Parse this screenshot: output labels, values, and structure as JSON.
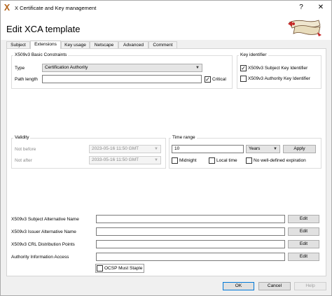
{
  "window": {
    "title": "X Certificate and Key management",
    "help_glyph": "?",
    "close_glyph": "✕"
  },
  "dialog": {
    "heading": "Edit XCA template"
  },
  "tabs": [
    {
      "label": "Subject"
    },
    {
      "label": "Extensions"
    },
    {
      "label": "Key usage"
    },
    {
      "label": "Netscape"
    },
    {
      "label": "Advanced"
    },
    {
      "label": "Comment"
    }
  ],
  "basic_constraints": {
    "title": "X509v3 Basic Constraints",
    "type_label": "Type",
    "type_value": "Certification Authority",
    "path_length_label": "Path length",
    "path_length_value": "",
    "critical_label": "Critical",
    "critical_checked": true
  },
  "key_identifier": {
    "title": "Key identifier",
    "subject_key_label": "X509v3 Subject Key Identifier",
    "subject_key_checked": true,
    "authority_key_label": "X509v3 Authority Key Identifier",
    "authority_key_checked": false
  },
  "validity": {
    "title": "Validity",
    "not_before_label": "Not before",
    "not_before_value": "2023-05-16 11:50 GMT",
    "not_after_label": "Not after",
    "not_after_value": "2033-05-16 11:50 GMT"
  },
  "time_range": {
    "title": "Time range",
    "amount": "10",
    "unit": "Years",
    "apply_label": "Apply",
    "midnight_label": "Midnight",
    "local_time_label": "Local time",
    "no_expiration_label": "No well-defined expiration"
  },
  "extensions": {
    "san_label": "X509v3 Subject Alternative Name",
    "ian_label": "X509v3 Issuer Alternative Name",
    "crl_label": "X509v3 CRL Distribution Points",
    "aia_label": "Authority Information Access",
    "edit_label": "Edit",
    "ocsp_label": "OCSP Must Staple"
  },
  "footer": {
    "ok_label": "OK",
    "cancel_label": "Cancel",
    "help_label": "Help"
  }
}
